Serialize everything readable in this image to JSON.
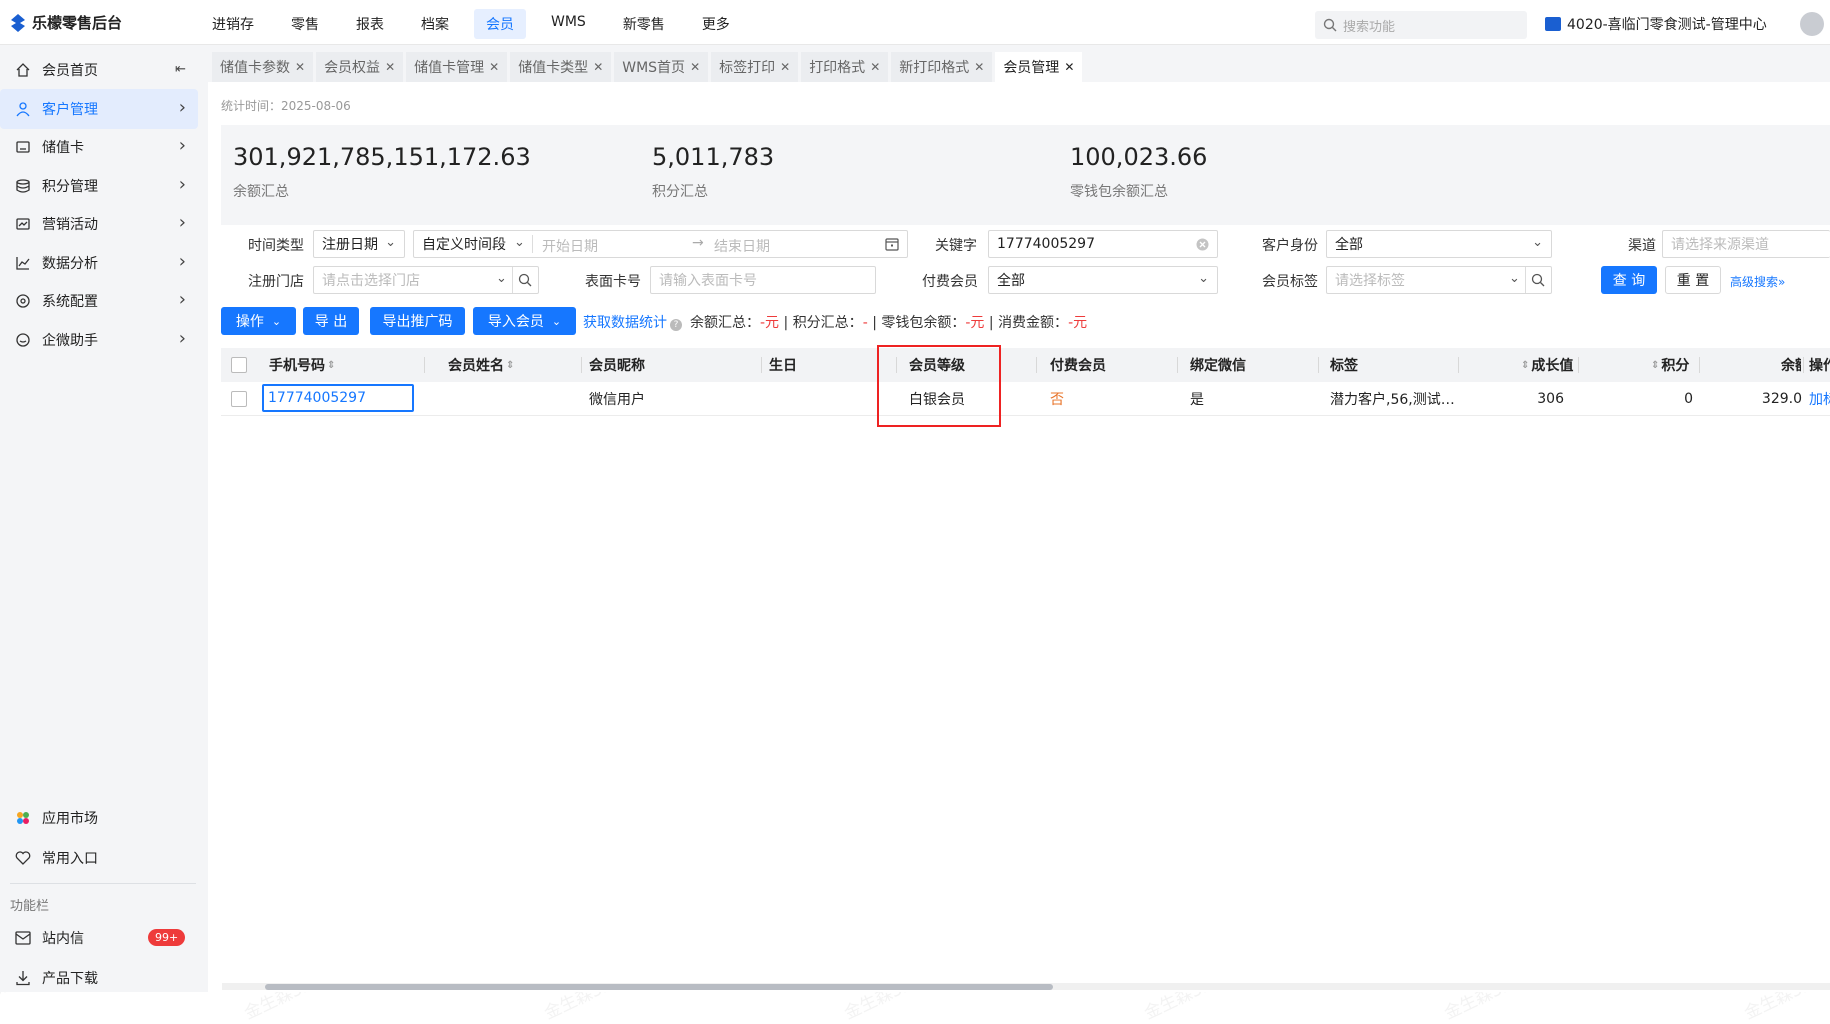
{
  "app": {
    "title": "乐檬零售后台"
  },
  "topnav": [
    "进销存",
    "零售",
    "报表",
    "档案",
    "会员",
    "WMS",
    "新零售",
    "更多"
  ],
  "topnav_active": 4,
  "search": {
    "placeholder": "搜索功能"
  },
  "store": {
    "label": "4020-喜临门零食测试-管理中心"
  },
  "sidebar": {
    "items": [
      {
        "label": "会员首页",
        "icon": "home-icon"
      },
      {
        "label": "客户管理",
        "icon": "user-icon"
      },
      {
        "label": "储值卡",
        "icon": "card-icon"
      },
      {
        "label": "积分管理",
        "icon": "database-icon"
      },
      {
        "label": "营销活动",
        "icon": "campaign-icon"
      },
      {
        "label": "数据分析",
        "icon": "chart-icon"
      },
      {
        "label": "系统配置",
        "icon": "settings-icon"
      },
      {
        "label": "企微助手",
        "icon": "chat-icon"
      }
    ],
    "bottom": {
      "app_market": "应用市场",
      "favorites": "常用入口",
      "section_label": "功能栏",
      "messages": "站内信",
      "messages_badge": "99+",
      "download": "产品下载"
    }
  },
  "tabs": [
    "储值卡参数",
    "会员权益",
    "储值卡管理",
    "储值卡类型",
    "WMS首页",
    "标签打印",
    "打印格式",
    "新打印格式",
    "会员管理"
  ],
  "active_tab": 8,
  "stat_time": "统计时间：2025-08-06",
  "stats": [
    {
      "value": "301,921,785,151,172.63",
      "label": "余额汇总"
    },
    {
      "value": "5,011,783",
      "label": "积分汇总"
    },
    {
      "value": "100,023.66",
      "label": "零钱包余额汇总"
    }
  ],
  "filters": {
    "time_type_label": "时间类型",
    "time_type_value": "注册日期",
    "time_range_value": "自定义时间段",
    "start_date_placeholder": "开始日期",
    "arrow": "→",
    "end_date_placeholder": "结束日期",
    "keyword_label": "关键字",
    "keyword_value": "17774005297",
    "identity_label": "客户身份",
    "identity_value": "全部",
    "channel_label": "渠道",
    "channel_placeholder": "请选择来源渠道",
    "store_label": "注册门店",
    "store_placeholder": "请点击选择门店",
    "card_label": "表面卡号",
    "card_placeholder": "请输入表面卡号",
    "paid_label": "付费会员",
    "paid_value": "全部",
    "tag_label": "会员标签",
    "tag_placeholder": "请选择标签",
    "query": "查 询",
    "reset": "重 置",
    "advanced": "高级搜索"
  },
  "actions": {
    "operate": "操作",
    "export": "导 出",
    "export_code": "导出推广码",
    "import": "导入会员",
    "fetch_stats": "获取数据统计",
    "sum_balance_label": "余额汇总：",
    "sum_balance_value": "-元",
    "sum_points_label": "积分汇总：",
    "sum_points_value": "-",
    "sum_wallet_label": "零钱包余额：",
    "sum_wallet_value": "-元",
    "sum_consume_label": "消费金额：",
    "sum_consume_value": "-元"
  },
  "table": {
    "columns": [
      "手机号码",
      "会员姓名",
      "会员昵称",
      "生日",
      "会员等级",
      "付费会员",
      "绑定微信",
      "标签",
      "成长值",
      "积分",
      "余额",
      "操作"
    ],
    "rows": [
      {
        "phone": "17774005297",
        "name": "",
        "nickname": "微信用户",
        "birthday": "",
        "level": "白银会员",
        "paid": "否",
        "wechat": "是",
        "tags": "潜力客户,56,测试…",
        "growth": "306",
        "points": "0",
        "balance": "329.0",
        "action": "加标"
      }
    ]
  },
  "watermark": "金生森5297",
  "colors": {
    "accent": "#1677ff",
    "danger": "#ee3b3b",
    "paid_no": "#e8742a",
    "highlight": "#e22"
  }
}
